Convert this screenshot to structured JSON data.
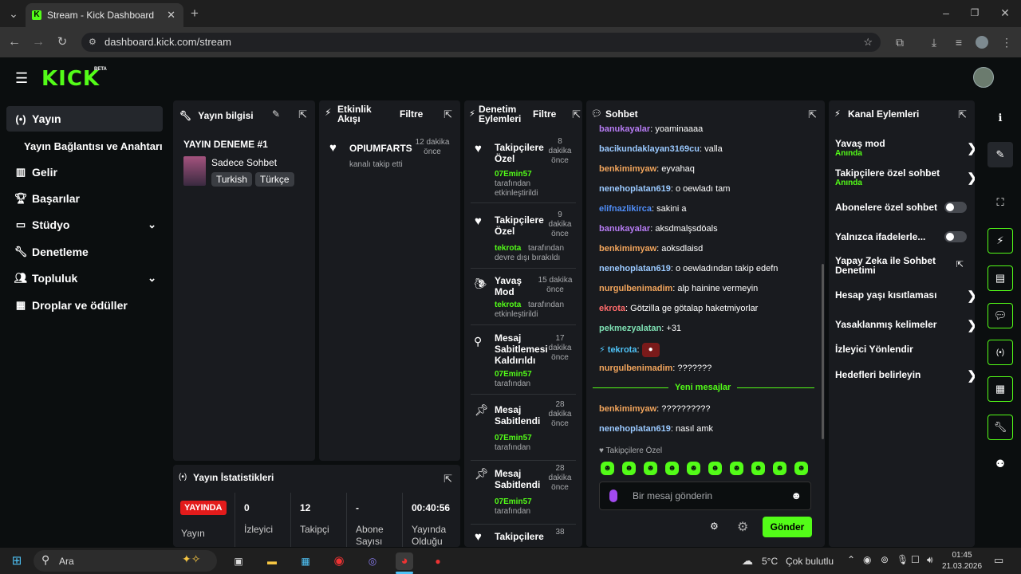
{
  "browser": {
    "tab_title": "Stream - Kick Dashboard",
    "url": "dashboard.kick.com/stream"
  },
  "app": {
    "logo": "KICK",
    "logo_badge": "BETA"
  },
  "sidebar": {
    "items": [
      {
        "label": "Yayın",
        "icon": "broadcast-icon"
      },
      {
        "label": "Yayın Bağlantısı ve Anahtarı"
      },
      {
        "label": "Gelir",
        "icon": "chart-icon"
      },
      {
        "label": "Başarılar",
        "icon": "trophy-icon"
      },
      {
        "label": "Stüdyo",
        "icon": "studio-icon"
      },
      {
        "label": "Denetleme",
        "icon": "wrench-icon"
      },
      {
        "label": "Topluluk",
        "icon": "people-icon"
      },
      {
        "label": "Droplar ve ödüller",
        "icon": "gift-icon"
      }
    ]
  },
  "stream_info": {
    "title": "Yayın bilgisi",
    "stream_title": "YAYIN DENEME #1",
    "category": "Sadece Sohbet",
    "tags": [
      "Turkish",
      "Türkçe"
    ]
  },
  "activity": {
    "title": "Etkinlik Akışı",
    "filter": "Filtre",
    "items": [
      {
        "name": "OPIUMFARTS",
        "desc": "kanalı takip etti",
        "time": "12 dakika önce"
      }
    ]
  },
  "moderation": {
    "title": "Denetim Eylemleri",
    "filter": "Filtre",
    "items": [
      {
        "title": "Takipçilere Özel",
        "user": "07Emin57",
        "desc": "tarafından etkinleştirildi",
        "time": "8 dakika önce"
      },
      {
        "title": "Takipçilere Özel",
        "user": "tekrota",
        "desc": "tarafından devre dışı bırakıldı",
        "time": "9 dakika önce"
      },
      {
        "title": "Yavaş Mod",
        "user": "tekrota",
        "desc": "tarafından etkinleştirildi",
        "time": "15 dakika önce"
      },
      {
        "title": "Mesaj Sabitlemesi Kaldırıldı",
        "user": "07Emin57",
        "desc": "tarafından",
        "time": "17 dakika önce"
      },
      {
        "title": "Mesaj Sabitlendi",
        "user": "07Emin57",
        "desc": "tarafından",
        "time": "28 dakika önce"
      },
      {
        "title": "Mesaj Sabitlendi",
        "user": "07Emin57",
        "desc": "tarafından",
        "time": "28 dakika önce"
      },
      {
        "title": "Takipçilere",
        "user": "",
        "desc": "",
        "time": "38"
      }
    ]
  },
  "chat": {
    "title": "Sohbet",
    "messages": [
      {
        "user": "banukayalar",
        "text": "yoaminaaaa",
        "color": "#b77cf4"
      },
      {
        "user": "bacikundaklayan3169cu",
        "text": "valla",
        "color": "#9ac9ff"
      },
      {
        "user": "benkimimyaw",
        "text": "eyvahaq",
        "color": "#f2a55c"
      },
      {
        "user": "nenehoplatan619",
        "text": "o oewladı tam",
        "color": "#9ac9ff"
      },
      {
        "user": "elifnazlikirca",
        "text": "sakini a",
        "color": "#4f8df7"
      },
      {
        "user": "banukayalar",
        "text": "aksdmalşsdöals",
        "color": "#b77cf4"
      },
      {
        "user": "benkimimyaw",
        "text": "aoksdlaisd",
        "color": "#f2a55c"
      },
      {
        "user": "nenehoplatan619",
        "text": "o oewladından takip edefn",
        "color": "#9ac9ff"
      },
      {
        "user": "nurgulbenimadim",
        "text": "alp hainine vermeyin",
        "color": "#f2a55c"
      },
      {
        "user": "ekrota",
        "text": "Götzilla ge götalap haketmiyorlar",
        "color": "#ff6b6b"
      },
      {
        "user": "pekmezyalatan",
        "text": "+31",
        "color": "#7ee0b3"
      },
      {
        "user": "tekrota",
        "text": "",
        "color": "#4fc3f7"
      },
      {
        "user": "nurgulbenimadim",
        "text": "???????",
        "color": "#f2a55c"
      }
    ],
    "new_messages_label": "Yeni mesajlar",
    "new_messages": [
      {
        "user": "benkimimyaw",
        "text": "??????????",
        "color": "#f2a55c"
      },
      {
        "user": "nenehoplatan619",
        "text": "nasıl amk",
        "color": "#9ac9ff"
      }
    ],
    "followers_only_label": "Takipçilere Özel",
    "input_placeholder": "Bir mesaj gönderin",
    "send_label": "Gönder"
  },
  "channel_actions": {
    "title": "Kanal Eylemleri",
    "items": [
      {
        "label": "Yavaş mod",
        "sub": "Anında",
        "control": "chevron"
      },
      {
        "label": "Takipçilere özel sohbet",
        "sub": "Anında",
        "control": "chevron"
      },
      {
        "label": "Abonelere özel sohbet",
        "control": "toggle"
      },
      {
        "label": "Yalnızca ifadelerle...",
        "control": "toggle"
      },
      {
        "label": "Yapay Zeka ile Sohbet Denetimi",
        "control": "external"
      },
      {
        "label": "Hesap yaşı kısıtlaması",
        "control": "chevron"
      },
      {
        "label": "Yasaklanmış kelimeler",
        "control": "chevron"
      },
      {
        "label": "İzleyici Yönlendir",
        "control": "none"
      },
      {
        "label": "Hedefleri belirleyin",
        "control": "chevron"
      }
    ]
  },
  "stats": {
    "title": "Yayın İstatistikleri",
    "live_label": "YAYINDA",
    "stream_label": "Yayın",
    "viewers": "0",
    "viewers_label": "İzleyici",
    "followers": "12",
    "followers_label": "Takipçi",
    "subs": "-",
    "subs_label": "Abone Sayısı",
    "duration": "00:40:56",
    "duration_label": "Yayında Olduğu"
  },
  "taskbar": {
    "search": "Ara",
    "weather_temp": "5°C",
    "weather_desc": "Çok bulutlu",
    "time": "01:45",
    "date": "21.03.2026"
  },
  "colors": {
    "accent": "#53fc18",
    "panel": "#191b1f",
    "background": "#0b0e0f"
  }
}
